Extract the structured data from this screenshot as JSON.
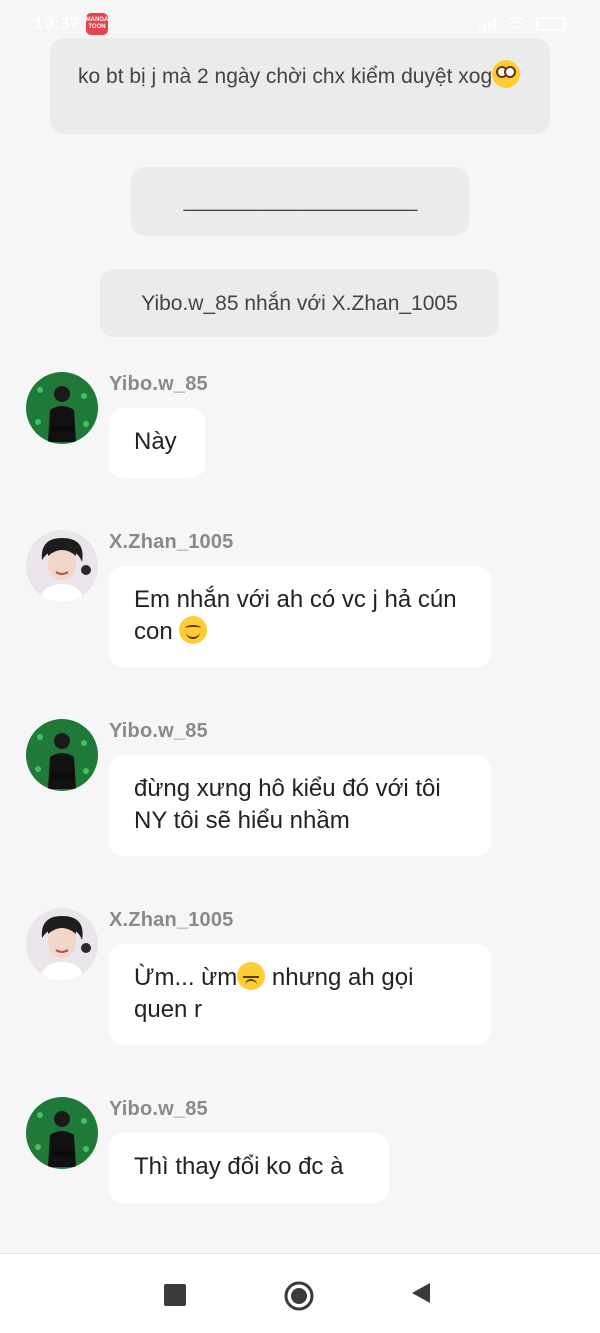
{
  "status_bar": {
    "time": "10:37",
    "app_badge_line1": "MANGA",
    "app_badge_line2": "TOON"
  },
  "system_messages": {
    "top_note": "ko bt bị j mà 2 ngày chời chx kiểm duyệt xog",
    "divider": "_______________________",
    "chat_note": "Yibo.w_85 nhắn với X.Zhan_1005"
  },
  "messages": [
    {
      "sender": "Yibo.w_85",
      "text": "Này",
      "avatar": "yibo-avatar"
    },
    {
      "sender": "X.Zhan_1005",
      "text": "Em nhắn với ah có vc j hả cún con",
      "avatar": "zhan-avatar"
    },
    {
      "sender": "Yibo.w_85",
      "text": "đừng xưng hô kiểu đó với tôi NY tôi sẽ hiểu nhầm",
      "avatar": "yibo-avatar"
    },
    {
      "sender": "X.Zhan_1005",
      "text_before": "Ừm... ừm",
      "text_after": " nhưng ah gọi quen r",
      "avatar": "zhan-avatar"
    },
    {
      "sender": "Yibo.w_85",
      "text": "Thì thay đổi ko đc à",
      "avatar": "yibo-avatar"
    }
  ],
  "icons": {
    "emoji_rolling_eyes": "face-with-rolling-eyes-icon",
    "emoji_smile": "smiling-face-icon",
    "emoji_sad": "disappointed-face-icon",
    "nav_recent": "square-icon",
    "nav_home": "circle-icon",
    "nav_back": "triangle-back-icon"
  },
  "colors": {
    "background": "#f6f6f6",
    "system_bubble": "#ebebeb",
    "message_bubble": "#ffffff",
    "sender_name": "#8a8a8a",
    "yibo_avatar_bg": "#1f7a3a"
  }
}
